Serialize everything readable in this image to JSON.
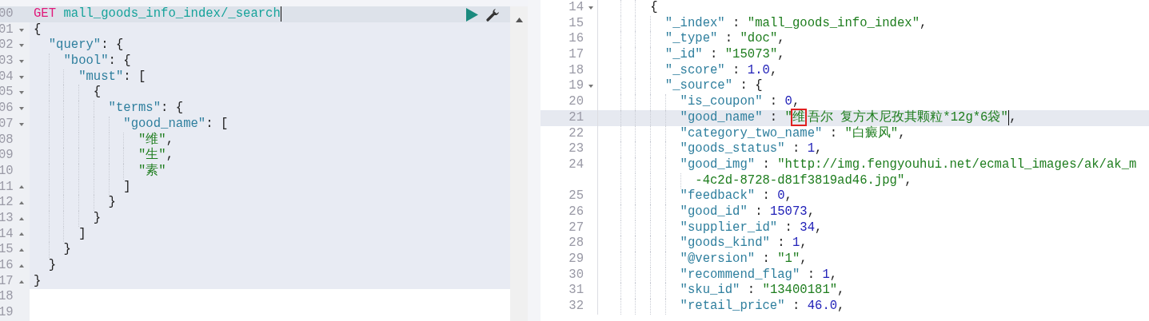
{
  "request_editor": {
    "lines": [
      {
        "number": "00",
        "selected": true,
        "active": true,
        "fold_start": false,
        "fold_end": false,
        "tokens": [
          {
            "kind": "method",
            "text": "GET"
          },
          {
            "kind": "path",
            "text": " mall_goods_info_index/_search"
          },
          {
            "kind": "cursor"
          }
        ]
      },
      {
        "number": "01",
        "selected": true,
        "active": false,
        "fold_start": true,
        "fold_end": false,
        "tokens": [
          {
            "kind": "punct",
            "text": "{"
          }
        ]
      },
      {
        "number": "02",
        "selected": true,
        "active": false,
        "fold_start": true,
        "fold_end": false,
        "tokens": [
          {
            "kind": "key",
            "text": "  \"query\""
          },
          {
            "kind": "punct",
            "text": ": {"
          }
        ]
      },
      {
        "number": "03",
        "selected": true,
        "active": false,
        "fold_start": true,
        "fold_end": false,
        "tokens": [
          {
            "kind": "key",
            "text": "    \"bool\""
          },
          {
            "kind": "punct",
            "text": ": {"
          }
        ]
      },
      {
        "number": "04",
        "selected": true,
        "active": false,
        "fold_start": true,
        "fold_end": false,
        "tokens": [
          {
            "kind": "key",
            "text": "      \"must\""
          },
          {
            "kind": "punct",
            "text": ": ["
          }
        ]
      },
      {
        "number": "05",
        "selected": true,
        "active": false,
        "fold_start": true,
        "fold_end": false,
        "tokens": [
          {
            "kind": "punct",
            "text": "        {"
          }
        ]
      },
      {
        "number": "06",
        "selected": true,
        "active": false,
        "fold_start": true,
        "fold_end": false,
        "tokens": [
          {
            "kind": "key",
            "text": "          \"terms\""
          },
          {
            "kind": "punct",
            "text": ": {"
          }
        ]
      },
      {
        "number": "07",
        "selected": true,
        "active": false,
        "fold_start": true,
        "fold_end": false,
        "tokens": [
          {
            "kind": "key",
            "text": "            \"good_name\""
          },
          {
            "kind": "punct",
            "text": ": ["
          }
        ]
      },
      {
        "number": "08",
        "selected": true,
        "active": false,
        "fold_start": false,
        "fold_end": false,
        "tokens": [
          {
            "kind": "string",
            "text": "              \"维\""
          },
          {
            "kind": "punct",
            "text": ","
          }
        ]
      },
      {
        "number": "09",
        "selected": true,
        "active": false,
        "fold_start": false,
        "fold_end": false,
        "tokens": [
          {
            "kind": "string",
            "text": "              \"生\""
          },
          {
            "kind": "punct",
            "text": ","
          }
        ]
      },
      {
        "number": "10",
        "selected": true,
        "active": false,
        "fold_start": false,
        "fold_end": false,
        "tokens": [
          {
            "kind": "string",
            "text": "              \"素\""
          }
        ]
      },
      {
        "number": "11",
        "selected": true,
        "active": false,
        "fold_start": false,
        "fold_end": true,
        "tokens": [
          {
            "kind": "punct",
            "text": "            ]"
          }
        ]
      },
      {
        "number": "12",
        "selected": true,
        "active": false,
        "fold_start": false,
        "fold_end": true,
        "tokens": [
          {
            "kind": "punct",
            "text": "          }"
          }
        ]
      },
      {
        "number": "13",
        "selected": true,
        "active": false,
        "fold_start": false,
        "fold_end": true,
        "tokens": [
          {
            "kind": "punct",
            "text": "        }"
          }
        ]
      },
      {
        "number": "14",
        "selected": true,
        "active": false,
        "fold_start": false,
        "fold_end": true,
        "tokens": [
          {
            "kind": "punct",
            "text": "      ]"
          }
        ]
      },
      {
        "number": "15",
        "selected": true,
        "active": false,
        "fold_start": false,
        "fold_end": true,
        "tokens": [
          {
            "kind": "punct",
            "text": "    }"
          }
        ]
      },
      {
        "number": "16",
        "selected": true,
        "active": false,
        "fold_start": false,
        "fold_end": true,
        "tokens": [
          {
            "kind": "punct",
            "text": "  }"
          }
        ]
      },
      {
        "number": "17",
        "selected": true,
        "active": false,
        "fold_start": false,
        "fold_end": true,
        "tokens": [
          {
            "kind": "punct",
            "text": "}"
          }
        ]
      },
      {
        "number": "18",
        "selected": false,
        "active": false,
        "fold_start": false,
        "fold_end": false
      },
      {
        "number": "19",
        "selected": false,
        "active": false,
        "fold_start": false,
        "fold_end": false
      }
    ]
  },
  "response_editor": {
    "lines": [
      {
        "number": "14",
        "active": false,
        "fold_start": true,
        "fold_end": false,
        "tokens": [
          {
            "kind": "punct",
            "text": "      {"
          }
        ]
      },
      {
        "number": "15",
        "active": false,
        "fold_start": false,
        "fold_end": false,
        "tokens": [
          {
            "kind": "key",
            "text": "        \"_index\""
          },
          {
            "kind": "punct",
            "text": " : "
          },
          {
            "kind": "string",
            "text": "\"mall_goods_info_index\""
          },
          {
            "kind": "punct",
            "text": ","
          }
        ]
      },
      {
        "number": "16",
        "active": false,
        "fold_start": false,
        "fold_end": false,
        "tokens": [
          {
            "kind": "key",
            "text": "        \"_type\""
          },
          {
            "kind": "punct",
            "text": " : "
          },
          {
            "kind": "string",
            "text": "\"doc\""
          },
          {
            "kind": "punct",
            "text": ","
          }
        ]
      },
      {
        "number": "17",
        "active": false,
        "fold_start": false,
        "fold_end": false,
        "tokens": [
          {
            "kind": "key",
            "text": "        \"_id\""
          },
          {
            "kind": "punct",
            "text": " : "
          },
          {
            "kind": "string",
            "text": "\"15073\""
          },
          {
            "kind": "punct",
            "text": ","
          }
        ]
      },
      {
        "number": "18",
        "active": false,
        "fold_start": false,
        "fold_end": false,
        "tokens": [
          {
            "kind": "key",
            "text": "        \"_score\""
          },
          {
            "kind": "punct",
            "text": " : "
          },
          {
            "kind": "number",
            "text": "1.0"
          },
          {
            "kind": "punct",
            "text": ","
          }
        ]
      },
      {
        "number": "19",
        "active": false,
        "fold_start": true,
        "fold_end": false,
        "tokens": [
          {
            "kind": "key",
            "text": "        \"_source\""
          },
          {
            "kind": "punct",
            "text": " : {"
          }
        ]
      },
      {
        "number": "20",
        "active": false,
        "fold_start": false,
        "fold_end": false,
        "tokens": [
          {
            "kind": "key",
            "text": "          \"is_coupon\""
          },
          {
            "kind": "punct",
            "text": " : "
          },
          {
            "kind": "number",
            "text": "0"
          },
          {
            "kind": "punct",
            "text": ","
          }
        ]
      },
      {
        "number": "21",
        "active": true,
        "fold_start": false,
        "fold_end": false,
        "tokens": [
          {
            "kind": "key",
            "text": "          \"good_name\""
          },
          {
            "kind": "punct",
            "text": " : "
          },
          {
            "kind": "string",
            "text": "\""
          },
          {
            "kind": "boxed",
            "text": "维"
          },
          {
            "kind": "string",
            "text": "吾尔 复方木尼孜其颗粒*12g*6袋\""
          },
          {
            "kind": "cursor"
          },
          {
            "kind": "punct",
            "text": ","
          }
        ]
      },
      {
        "number": "22",
        "active": false,
        "fold_start": false,
        "fold_end": false,
        "tokens": [
          {
            "kind": "key",
            "text": "          \"category_two_name\""
          },
          {
            "kind": "punct",
            "text": " : "
          },
          {
            "kind": "string",
            "text": "\"白癜风\""
          },
          {
            "kind": "punct",
            "text": ","
          }
        ]
      },
      {
        "number": "23",
        "active": false,
        "fold_start": false,
        "fold_end": false,
        "tokens": [
          {
            "kind": "key",
            "text": "          \"goods_status\""
          },
          {
            "kind": "punct",
            "text": " : "
          },
          {
            "kind": "number",
            "text": "1"
          },
          {
            "kind": "punct",
            "text": ","
          }
        ]
      },
      {
        "number": "24",
        "active": false,
        "fold_start": false,
        "fold_end": false,
        "tokens": [
          {
            "kind": "key",
            "text": "          \"good_img\""
          },
          {
            "kind": "punct",
            "text": " : "
          },
          {
            "kind": "string",
            "text": "\"http://img.fengyouhui.net/ecmall_images/ak/ak_m"
          }
        ],
        "wrap": [
          {
            "kind": "string",
            "text": "            -4c2d-8728-d81f3819ad46.jpg\""
          },
          {
            "kind": "punct",
            "text": ","
          }
        ]
      },
      {
        "number": "25",
        "active": false,
        "fold_start": false,
        "fold_end": false,
        "tokens": [
          {
            "kind": "key",
            "text": "          \"feedback\""
          },
          {
            "kind": "punct",
            "text": " : "
          },
          {
            "kind": "number",
            "text": "0"
          },
          {
            "kind": "punct",
            "text": ","
          }
        ]
      },
      {
        "number": "26",
        "active": false,
        "fold_start": false,
        "fold_end": false,
        "tokens": [
          {
            "kind": "key",
            "text": "          \"good_id\""
          },
          {
            "kind": "punct",
            "text": " : "
          },
          {
            "kind": "number",
            "text": "15073"
          },
          {
            "kind": "punct",
            "text": ","
          }
        ]
      },
      {
        "number": "27",
        "active": false,
        "fold_start": false,
        "fold_end": false,
        "tokens": [
          {
            "kind": "key",
            "text": "          \"supplier_id\""
          },
          {
            "kind": "punct",
            "text": " : "
          },
          {
            "kind": "number",
            "text": "34"
          },
          {
            "kind": "punct",
            "text": ","
          }
        ]
      },
      {
        "number": "28",
        "active": false,
        "fold_start": false,
        "fold_end": false,
        "tokens": [
          {
            "kind": "key",
            "text": "          \"goods_kind\""
          },
          {
            "kind": "punct",
            "text": " : "
          },
          {
            "kind": "number",
            "text": "1"
          },
          {
            "kind": "punct",
            "text": ","
          }
        ]
      },
      {
        "number": "29",
        "active": false,
        "fold_start": false,
        "fold_end": false,
        "tokens": [
          {
            "kind": "key",
            "text": "          \"@version\""
          },
          {
            "kind": "punct",
            "text": " : "
          },
          {
            "kind": "string",
            "text": "\"1\""
          },
          {
            "kind": "punct",
            "text": ","
          }
        ]
      },
      {
        "number": "30",
        "active": false,
        "fold_start": false,
        "fold_end": false,
        "tokens": [
          {
            "kind": "key",
            "text": "          \"recommend_flag\""
          },
          {
            "kind": "punct",
            "text": " : "
          },
          {
            "kind": "number",
            "text": "1"
          },
          {
            "kind": "punct",
            "text": ","
          }
        ]
      },
      {
        "number": "31",
        "active": false,
        "fold_start": false,
        "fold_end": false,
        "tokens": [
          {
            "kind": "key",
            "text": "          \"sku_id\""
          },
          {
            "kind": "punct",
            "text": " : "
          },
          {
            "kind": "string",
            "text": "\"13400181\""
          },
          {
            "kind": "punct",
            "text": ","
          }
        ]
      },
      {
        "number": "32",
        "active": false,
        "fold_start": false,
        "fold_end": false,
        "tokens": [
          {
            "kind": "key",
            "text": "          \"retail_price\""
          },
          {
            "kind": "punct",
            "text": " : "
          },
          {
            "kind": "number",
            "text": "46.0"
          },
          {
            "kind": "punct",
            "text": ","
          }
        ]
      }
    ]
  }
}
